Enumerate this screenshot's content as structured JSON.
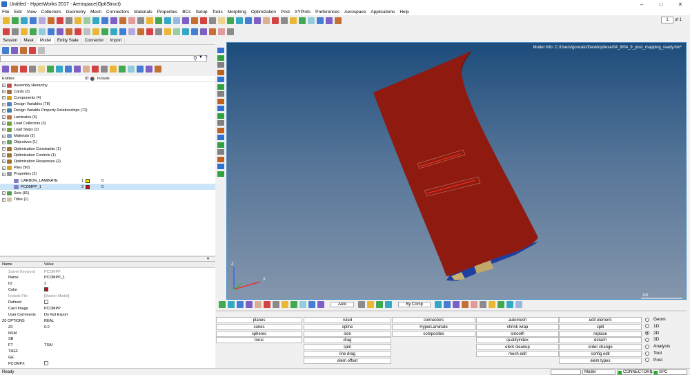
{
  "window": {
    "title": "Untitled - HyperWorks 2017 - Aerospace(OptiStruct)"
  },
  "menu": [
    "File",
    "Edit",
    "View",
    "Collectors",
    "Geometry",
    "Mesh",
    "Connectors",
    "Materials",
    "Properties",
    "BCs",
    "Setup",
    "Tools",
    "Morphing",
    "Optimization",
    "Post",
    "XYPlots",
    "Preferences",
    "Aerospace",
    "Applications",
    "Help"
  ],
  "page_indicator": {
    "value": "1",
    "of": "of 1"
  },
  "browser_tabs": [
    "Session",
    "Mask",
    "Model",
    "Entity State",
    "Connector",
    "Import"
  ],
  "tree": {
    "header": {
      "entities": "Entities",
      "id": "ID",
      "include": "Include"
    },
    "items": [
      {
        "label": "Assembly Hierarchy"
      },
      {
        "label": "Cards (3)"
      },
      {
        "label": "Components (4)"
      },
      {
        "label": "Design Variables (78)"
      },
      {
        "label": "Design Variable Property Relationships (72)"
      },
      {
        "label": "Laminates (6)"
      },
      {
        "label": "Load Collectors (3)"
      },
      {
        "label": "Load Steps (2)"
      },
      {
        "label": "Materials (2)"
      },
      {
        "label": "Objectives (1)"
      },
      {
        "label": "Optimization Constraints (1)"
      },
      {
        "label": "Optimization Controls (1)"
      },
      {
        "label": "Optimization Responses (2)"
      },
      {
        "label": "Plies (90)"
      },
      {
        "label": "Properties (2)"
      },
      {
        "label": "CARBON_LAMINATE",
        "id": "1",
        "color": "#f5e000",
        "inc": "0"
      },
      {
        "label": "PCOMPP_1",
        "id": "2",
        "color": "#d01010",
        "inc": "0"
      },
      {
        "label": "Sets (81)"
      },
      {
        "label": "Titles (1)"
      }
    ]
  },
  "props": {
    "header": {
      "name": "Name",
      "value": "Value"
    },
    "rows": [
      {
        "n": "Solver Keyword",
        "v": "PCOMPP"
      },
      {
        "n": "Name",
        "v": "PCOMPP_1"
      },
      {
        "n": "ID",
        "v": "2"
      },
      {
        "n": "Color",
        "v": ""
      },
      {
        "n": "Include File",
        "v": "[Master Model]"
      },
      {
        "n": "Defined",
        "v": ""
      },
      {
        "n": "Card Image",
        "v": "PCOMPP"
      },
      {
        "n": "User Comments",
        "v": "Do Not Export"
      },
      {
        "n": "Z0 OPTIONS",
        "v": "REAL"
      },
      {
        "n": "Z0",
        "v": "0.0"
      },
      {
        "n": "NSM",
        "v": ""
      },
      {
        "n": "SB",
        "v": ""
      },
      {
        "n": "FT",
        "v": "TSAI"
      },
      {
        "n": "TREF",
        "v": ""
      },
      {
        "n": "GE",
        "v": ""
      },
      {
        "n": "PCOMPX",
        "v": ""
      }
    ]
  },
  "viewport": {
    "model_info": "Model Info: C:/Users/goncalo/Desktop/tese/04_9/04_9_post_mapping_ready.hm*",
    "scale": "100",
    "axis": {
      "z": "Z",
      "x": "X"
    }
  },
  "bottom_toolbar": {
    "auto": "Auto",
    "bycomp": "By Comp"
  },
  "panel": {
    "col1": [
      "planes",
      "cones",
      "spheres",
      "torus"
    ],
    "col2": [
      "ruled",
      "spline",
      "skin",
      "drag",
      "spin",
      "line drag",
      "elem offset"
    ],
    "col3": [
      "connectors",
      "HyperLaminate",
      "composites"
    ],
    "col4": [
      "automesh",
      "shrink wrap",
      "smooth",
      "qualityindex",
      "elem cleanup",
      "mesh edit"
    ],
    "col5": [
      "edit element",
      "split",
      "replace",
      "detach",
      "order change",
      "config edit",
      "elem types"
    ]
  },
  "radios": [
    {
      "label": "Geom",
      "on": false
    },
    {
      "label": "1D",
      "on": false
    },
    {
      "label": "2D",
      "on": true
    },
    {
      "label": "3D",
      "on": false
    },
    {
      "label": "Analysis",
      "on": false
    },
    {
      "label": "Tool",
      "on": false
    },
    {
      "label": "Post",
      "on": false
    }
  ],
  "status": {
    "ready": "Ready",
    "model": "Model",
    "connectors": "CONNECTORS",
    "spc": "SPC"
  }
}
